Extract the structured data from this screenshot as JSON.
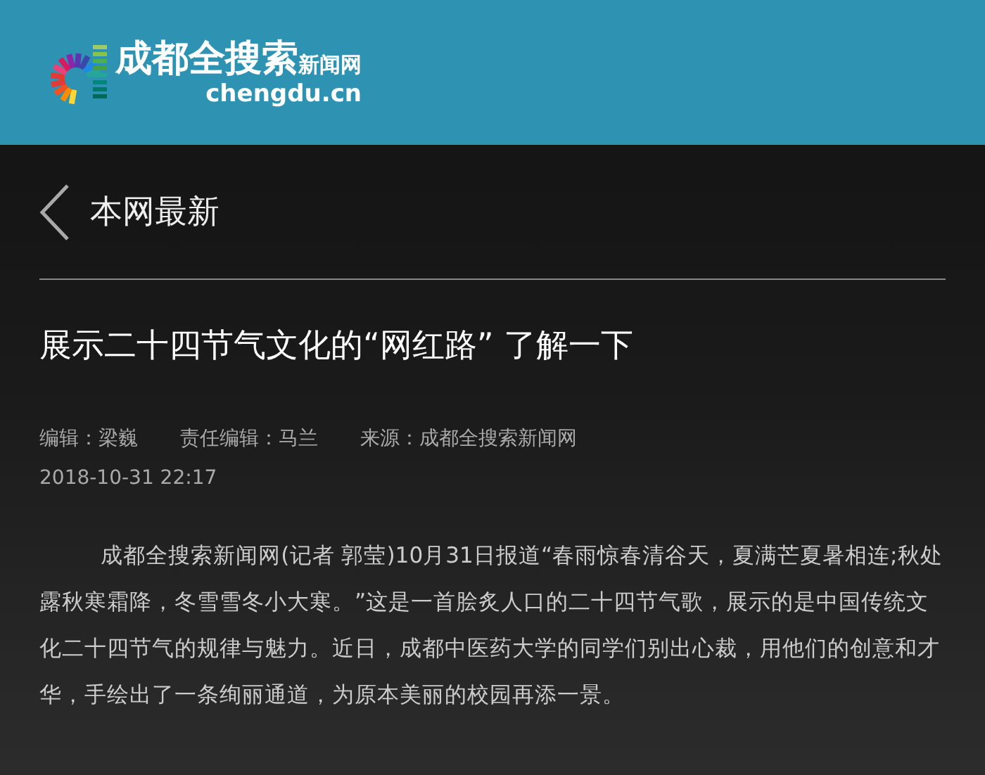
{
  "header": {
    "logo_title": "成都全搜索",
    "logo_subtitle": "新闻网",
    "logo_domain": "chengdu.cn"
  },
  "nav": {
    "back_label": "本网最新"
  },
  "article": {
    "title": "展示二十四节气文化的“网红路” 了解一下",
    "meta": [
      {
        "label": "编辑：",
        "value": "梁巍"
      },
      {
        "label": "责任编辑：",
        "value": "马兰"
      },
      {
        "label": "来源：",
        "value": "成都全搜索新闻网"
      }
    ],
    "date": "2018-10-31 22:17",
    "body": "成都全搜索新闻网(记者 郭莹)10月31日报道“春雨惊春清谷天，夏满芒夏暑相连;秋处露秋寒霜降，冬雪雪冬小大寒。”这是一首脍炙人口的二十四节气歌，展示的是中国传统文化二十四节气的规律与魅力。近日，成都中医药大学的同学们别出心裁，用他们的创意和才华，手绘出了一条绚丽通道，为原本美丽的校园再添一景。"
  }
}
